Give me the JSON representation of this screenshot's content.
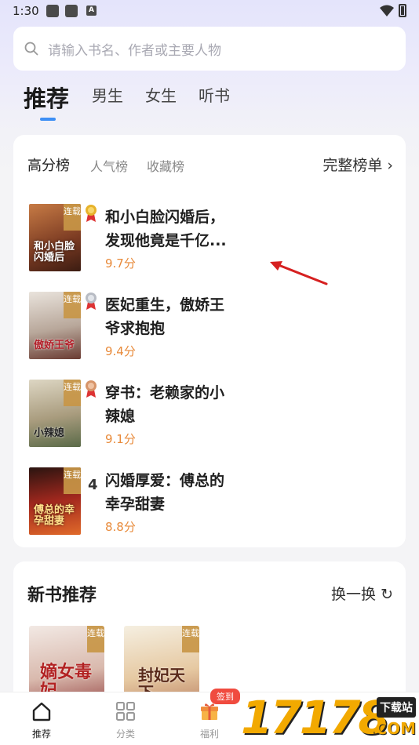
{
  "status": {
    "time": "1:30",
    "icons": [
      "app-icon",
      "app-icon",
      "a-icon",
      "wifi-icon",
      "battery-icon"
    ]
  },
  "search": {
    "placeholder": "请输入书名、作者或主要人物"
  },
  "top_tabs": [
    {
      "label": "推荐",
      "active": true
    },
    {
      "label": "男生",
      "active": false
    },
    {
      "label": "女生",
      "active": false
    },
    {
      "label": "听书",
      "active": false
    }
  ],
  "rank": {
    "tabs": [
      {
        "label": "高分榜",
        "active": true
      },
      {
        "label": "人气榜",
        "active": false
      },
      {
        "label": "收藏榜",
        "active": false
      }
    ],
    "full_list_label": "完整榜单 ›",
    "books": [
      {
        "rank": "1",
        "medal": "gold",
        "title": "和小白脸闪婚后，发现他竟是千亿...",
        "score": "9.7分",
        "tag": "连载",
        "cover_text": "和小白脸闪婚后"
      },
      {
        "rank": "2",
        "medal": "silver",
        "title": "医妃重生，傲娇王爷求抱抱",
        "score": "9.4分",
        "tag": "连载",
        "cover_text": "傲娇王爷"
      },
      {
        "rank": "3",
        "medal": "bronze",
        "title": "穿书：老赖家的小辣媳",
        "score": "9.1分",
        "tag": "连载",
        "cover_text": "小辣媳"
      },
      {
        "rank": "4",
        "medal": "",
        "title": "闪婚厚爱：傅总的幸孕甜妻",
        "score": "8.8分",
        "tag": "连载",
        "cover_text": "傅总的幸孕甜妻"
      }
    ]
  },
  "new_books": {
    "title": "新书推荐",
    "swap_label": "换一换 ↻",
    "covers": [
      {
        "tag": "连载",
        "text": "嫡女毒妃"
      },
      {
        "tag": "连载",
        "text": "封妃天下"
      }
    ]
  },
  "bottom_nav": [
    {
      "label": "推荐",
      "icon": "home-icon",
      "active": true
    },
    {
      "label": "分类",
      "icon": "grid-icon",
      "active": false
    },
    {
      "label": "福利",
      "icon": "gift-icon",
      "active": false,
      "badge": "签到"
    }
  ],
  "watermark": {
    "digits": "17178",
    "box": "下载站",
    "com": ".COM"
  },
  "colors": {
    "accent": "#3d8ff5",
    "score": "#e88a3a",
    "badge": "#f04b3f"
  }
}
